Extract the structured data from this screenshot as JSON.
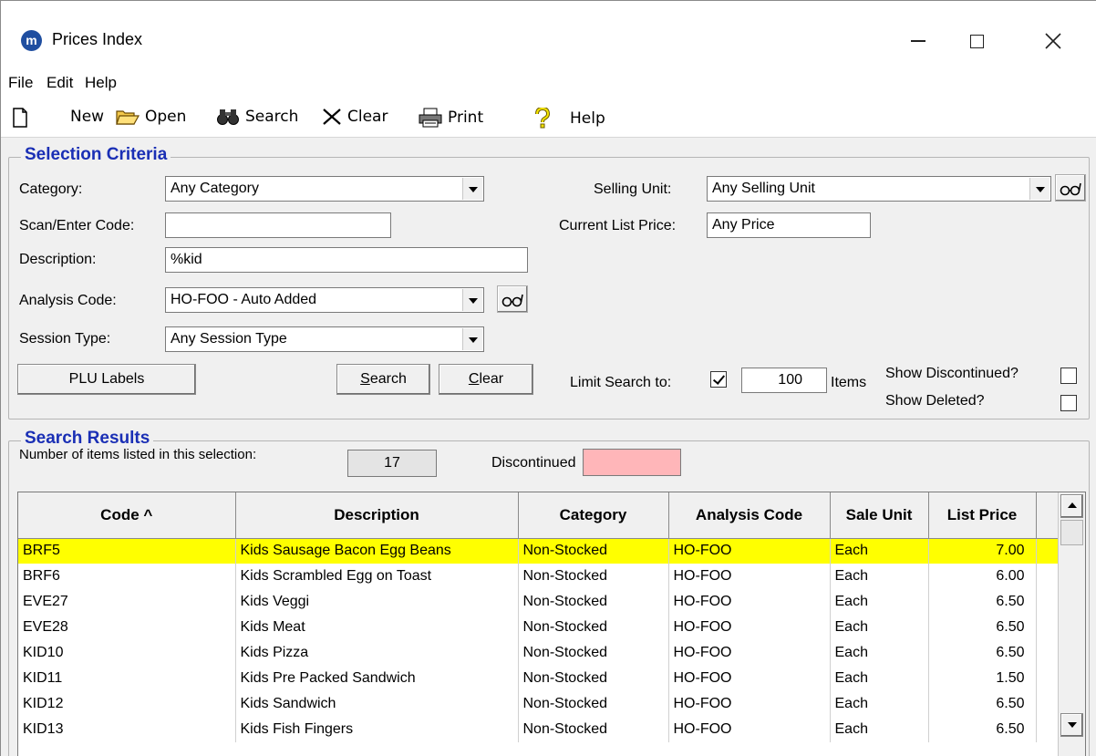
{
  "window": {
    "title": "Prices Index",
    "logo_letter": "m"
  },
  "menu": [
    "File",
    "Edit",
    "Help"
  ],
  "toolbar": {
    "new_label": "New",
    "open_label": "Open",
    "search_label": "Search",
    "clear_label": "Clear",
    "print_label": "Print",
    "help_label": "Help"
  },
  "criteria": {
    "title": "Selection Criteria",
    "category_label": "Category:",
    "category_value": "Any Category",
    "scan_label": "Scan/Enter Code:",
    "scan_value": "",
    "description_label": "Description:",
    "description_value": "%kid",
    "analysis_label": "Analysis Code:",
    "analysis_value": "HO-FOO - Auto Added",
    "session_label": "Session Type:",
    "session_value": "Any Session Type",
    "selling_unit_label": "Selling Unit:",
    "selling_unit_value": "Any Selling Unit",
    "list_price_label": "Current List Price:",
    "list_price_value": "Any Price",
    "plu_button": "PLU Labels",
    "search_button_u": "S",
    "search_button_rest": "earch",
    "clear_button_u": "C",
    "clear_button_rest": "lear",
    "limit_label": "Limit Search to:",
    "limit_checked": true,
    "limit_value": "100",
    "items_label": "Items",
    "show_discontinued_label": "Show Discontinued?",
    "show_deleted_label": "Show Deleted?"
  },
  "results": {
    "title": "Search Results",
    "count_label": "Number of items listed in this selection:",
    "count_value": "17",
    "discontinued_label": "Discontinued",
    "discontinued_color": "#ffb6b9",
    "selected_color": "#ffff00",
    "columns": [
      "Code ^",
      "Description",
      "Category",
      "Analysis Code",
      "Sale Unit",
      "List Price"
    ],
    "rows": [
      [
        "BRF5",
        "Kids Sausage Bacon Egg Beans",
        "Non-Stocked",
        "HO-FOO",
        "Each",
        "7.00"
      ],
      [
        "BRF6",
        "Kids Scrambled Egg on Toast",
        "Non-Stocked",
        "HO-FOO",
        "Each",
        "6.00"
      ],
      [
        "EVE27",
        "Kids Veggi",
        "Non-Stocked",
        "HO-FOO",
        "Each",
        "6.50"
      ],
      [
        "EVE28",
        "Kids Meat",
        "Non-Stocked",
        "HO-FOO",
        "Each",
        "6.50"
      ],
      [
        "KID10",
        "Kids Pizza",
        "Non-Stocked",
        "HO-FOO",
        "Each",
        "6.50"
      ],
      [
        "KID11",
        "Kids Pre Packed Sandwich",
        "Non-Stocked",
        "HO-FOO",
        "Each",
        "1.50"
      ],
      [
        "KID12",
        "Kids Sandwich",
        "Non-Stocked",
        "HO-FOO",
        "Each",
        "6.50"
      ],
      [
        "KID13",
        "Kids Fish Fingers",
        "Non-Stocked",
        "HO-FOO",
        "Each",
        "6.50"
      ]
    ]
  }
}
